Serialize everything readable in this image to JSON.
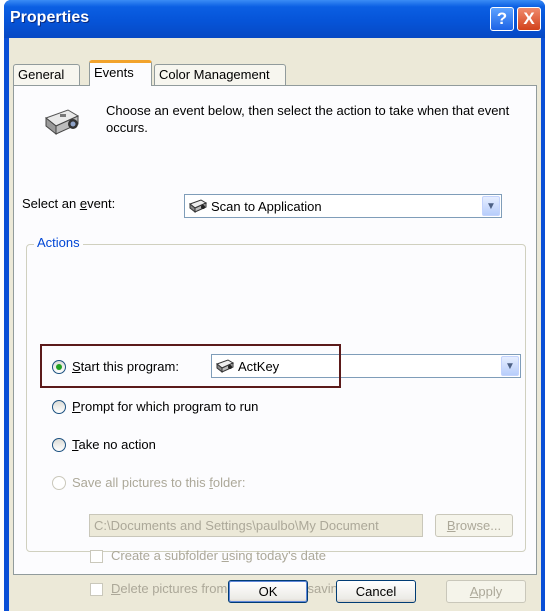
{
  "window": {
    "title": "Properties",
    "help_label": "?",
    "close_label": "X"
  },
  "tabs": [
    {
      "label": "General",
      "active": false
    },
    {
      "label": "Events",
      "active": true
    },
    {
      "label": "Color Management",
      "active": false
    }
  ],
  "description": "Choose an event below, then select the action to take when that event occurs.",
  "event": {
    "label_pre": "Select an ",
    "label_acc": "e",
    "label_post": "vent:",
    "selected": "Scan to Application"
  },
  "actions": {
    "group_title": "Actions",
    "start_program": {
      "acc": "S",
      "rest": "tart this program:",
      "checked": true,
      "program": "ActKey"
    },
    "prompt": {
      "acc": "P",
      "rest": "rompt for which program to run",
      "checked": false
    },
    "no_action": {
      "acc": "T",
      "rest": "ake no action",
      "checked": false
    },
    "save_pictures": {
      "pre": "Save all pictures to this ",
      "acc": "f",
      "post": "older:",
      "checked": false,
      "enabled": false
    },
    "folder_path": "C:\\Documents and Settings\\paulbo\\My Document",
    "browse": {
      "acc": "B",
      "rest": "rowse..."
    },
    "subfolder": {
      "pre": "Create a subfolder ",
      "acc": "u",
      "post": "sing today's date",
      "checked": false
    },
    "delete_after": {
      "acc": "D",
      "rest": "elete pictures from camera after saving them",
      "checked": false
    }
  },
  "buttons": {
    "ok": "OK",
    "cancel": "Cancel",
    "apply_acc": "A",
    "apply_rest": "pply"
  },
  "colors": {
    "titlebar": "#0654d8",
    "dialog_bg": "#ece9d8",
    "group_title": "#0046d5",
    "radio_dot": "#21a121",
    "highlight_border": "#5b1a1a"
  },
  "icons": [
    "scanner-icon",
    "scanner-small-icon",
    "chevron-down-icon"
  ]
}
